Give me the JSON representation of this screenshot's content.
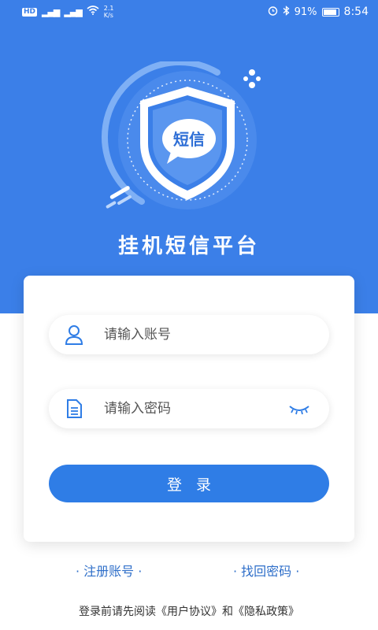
{
  "status_bar": {
    "hd_badge": "HD",
    "signal_1": "⁴ᴳ",
    "signal_2": "⁴ᴳ",
    "net_speed": "2.1\nK/s",
    "battery": "91%",
    "time": "8:54"
  },
  "app": {
    "logo_text": "短信",
    "title": "挂机短信平台"
  },
  "login": {
    "account_placeholder": "请输入账号",
    "password_placeholder": "请输入密码",
    "login_label": "登录"
  },
  "links": {
    "register": "· 注册账号 ·",
    "forgot": "· 找回密码 ·"
  },
  "agreement": {
    "prefix": "登录前请先阅读",
    "user_agreement": "《用户协议》",
    "and": "和",
    "privacy_policy": "《隐私政策》"
  },
  "colors": {
    "brand": "#3b7fe8",
    "button": "#2f7de6",
    "link": "#2f6fc9"
  }
}
